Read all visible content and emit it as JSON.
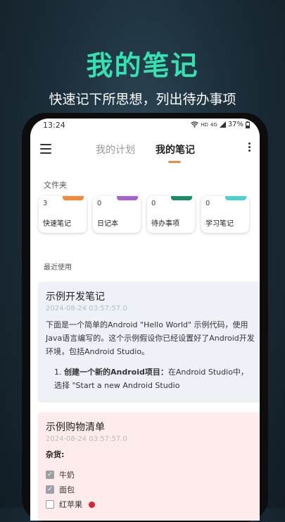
{
  "promo": {
    "title": "我的笔记",
    "subtitle": "快速记下所思想，列出待办事项"
  },
  "status_bar": {
    "time": "13:24",
    "network": "HD",
    "signal": "4G",
    "battery": "37%"
  },
  "top_bar": {
    "tabs": [
      {
        "label": "我的计划",
        "active": false
      },
      {
        "label": "我的笔记",
        "active": true
      }
    ],
    "accent_color": "#f08a3c"
  },
  "folders_section": {
    "label": "文件夹",
    "items": [
      {
        "count": "3",
        "name": "快速笔记",
        "color": "#f08a3c"
      },
      {
        "count": "0",
        "name": "日记本",
        "color": "#a664c9"
      },
      {
        "count": "0",
        "name": "待办事项",
        "color": "#1e8a6a"
      },
      {
        "count": "0",
        "name": "学习笔记",
        "color": "#4fcfcf"
      }
    ]
  },
  "recent_section": {
    "label": "最近使用"
  },
  "notes": [
    {
      "title": "示例开发笔记",
      "date": "2024-08-24 03:57:57.0",
      "body": "下面是一个简单的Android \"Hello World\" 示例代码，使用Java语言编写的。这个示例假设你已经设置好了Android开发环境，包括Android Studio。",
      "list_number": "1.",
      "list_bold": "创建一个新的Android项目：",
      "list_text": "在Android Studio中，选择 \"Start a new Android Studio",
      "bg_color": "#eef2f8"
    },
    {
      "title": "示例购物清单",
      "date": "2024-08-24 03:57:57.0",
      "group": "杂货:",
      "items": [
        {
          "label": "牛奶",
          "checked": true
        },
        {
          "label": "面包",
          "checked": true
        },
        {
          "label": "红苹果",
          "checked": false
        }
      ],
      "bg_color": "#fdeceb"
    }
  ]
}
